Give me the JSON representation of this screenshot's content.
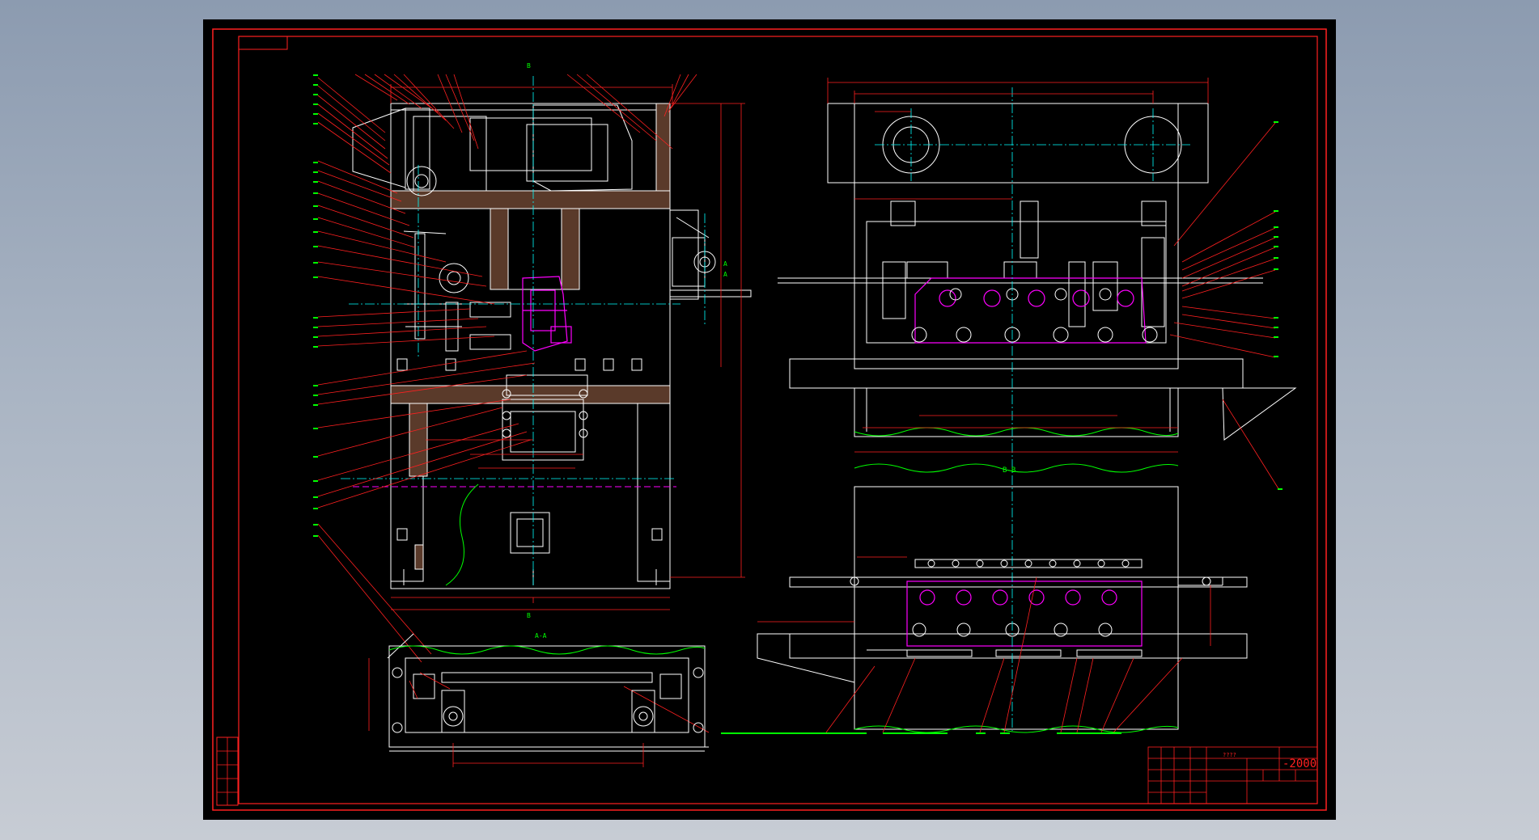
{
  "title_block": {
    "drawing_number": "-2000",
    "small_code": "????"
  },
  "section_labels": {
    "main_section": "B-B",
    "front_section": "A-A",
    "cut_marks": [
      "B",
      "B",
      "A",
      "A"
    ]
  },
  "colors": {
    "background_outer": "#9aa6b8",
    "sheet": "#000000",
    "border": "#ff2020",
    "geometry": "#ffffff",
    "leader": "#ff2020",
    "text": "#00ff00",
    "workpiece": "#ff00ff",
    "centerline": "#00ffff",
    "hidden": "#ffff00",
    "break_line": "#00ff00"
  }
}
